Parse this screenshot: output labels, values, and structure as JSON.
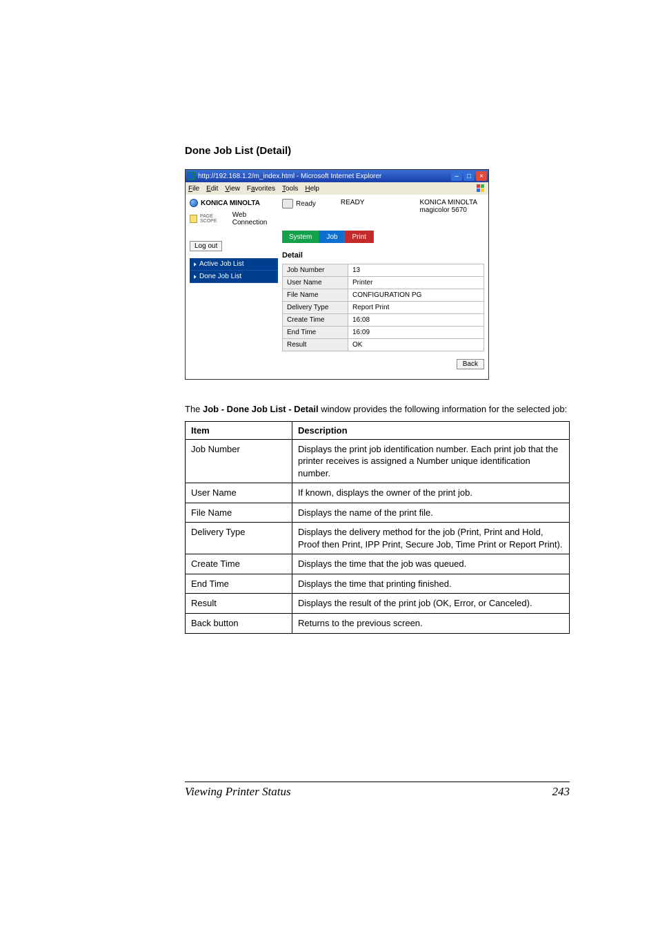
{
  "heading": "Done Job List (Detail)",
  "screenshot": {
    "window_title": "http://192.168.1.2/m_index.html - Microsoft Internet Explorer",
    "menus": {
      "file": "File",
      "edit": "Edit",
      "view": "View",
      "favorites": "Favorites",
      "tools": "Tools",
      "help": "Help"
    },
    "brand": "KONICA MINOLTA",
    "pagescope_prefix": "PAGE SCOPE",
    "webconnection": "Web Connection",
    "logout": "Log out",
    "nav": {
      "active": "Active Job List",
      "done": "Done Job List"
    },
    "ready_label": "Ready",
    "ready_status": "READY",
    "device_vendor": "KONICA MINOLTA",
    "device_model": "magicolor 5670",
    "tabs": {
      "system": "System",
      "job": "Job",
      "print": "Print"
    },
    "detail_title": "Detail",
    "fields": {
      "jobnum_k": "Job Number",
      "jobnum_v": "13",
      "user_k": "User Name",
      "user_v": "Printer",
      "file_k": "File Name",
      "file_v": "CONFIGURATION PG",
      "deliv_k": "Delivery Type",
      "deliv_v": "Report Print",
      "create_k": "Create Time",
      "create_v": "16:08",
      "end_k": "End Time",
      "end_v": "16:09",
      "result_k": "Result",
      "result_v": "OK"
    },
    "back": "Back"
  },
  "intro_pre": "The ",
  "intro_bold": "Job - Done Job List - Detail",
  "intro_post": " window provides the following information for the selected job:",
  "table": {
    "h1": "Item",
    "h2": "Description",
    "rows": [
      {
        "k": "Job Number",
        "v": "Displays the print job identification number. Each print job that the printer receives is assigned a Number unique identification number."
      },
      {
        "k": "User Name",
        "v": "If known, displays the owner of the print job."
      },
      {
        "k": "File Name",
        "v": "Displays the name of the print file."
      },
      {
        "k": "Delivery Type",
        "v": "Displays the delivery method for the job (Print, Print and Hold, Proof then Print, IPP Print, Secure Job, Time Print or Report Print)."
      },
      {
        "k": "Create Time",
        "v": "Displays the time that the job was queued."
      },
      {
        "k": "End Time",
        "v": "Displays the time that printing finished."
      },
      {
        "k": "Result",
        "v": "Displays the result of the print job (OK, Error, or Canceled)."
      },
      {
        "k": "Back button",
        "v": "Returns to the previous screen."
      }
    ]
  },
  "footer": {
    "title": "Viewing Printer Status",
    "page": "243"
  }
}
